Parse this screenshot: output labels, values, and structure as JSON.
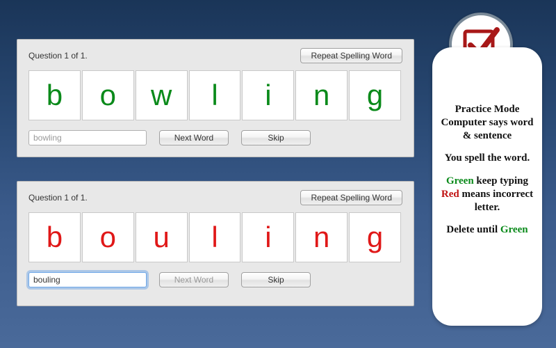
{
  "panel1": {
    "question": "Question 1 of 1.",
    "repeat_label": "Repeat Spelling Word",
    "letters": [
      "b",
      "o",
      "w",
      "l",
      "i",
      "n",
      "g"
    ],
    "letter_color": "green",
    "input_value": "bowling",
    "input_focused": false,
    "next_label": "Next Word",
    "next_enabled": true,
    "skip_label": "Skip"
  },
  "panel2": {
    "question": "Question 1 of 1.",
    "repeat_label": "Repeat Spelling Word",
    "letters": [
      "b",
      "o",
      "u",
      "l",
      "i",
      "n",
      "g"
    ],
    "letter_color": "red",
    "input_value": "bouling",
    "input_focused": true,
    "next_label": "Next Word",
    "next_enabled": false,
    "skip_label": "Skip"
  },
  "side": {
    "line1": "Practice Mode",
    "line2": "Computer says word & sentence",
    "line3": "You spell the word.",
    "green_word": "Green",
    "keep_typing": " keep typing",
    "red_word": "Red",
    "means": " means incorrect letter.",
    "delete_until": "Delete until ",
    "green_word2": "Green"
  }
}
